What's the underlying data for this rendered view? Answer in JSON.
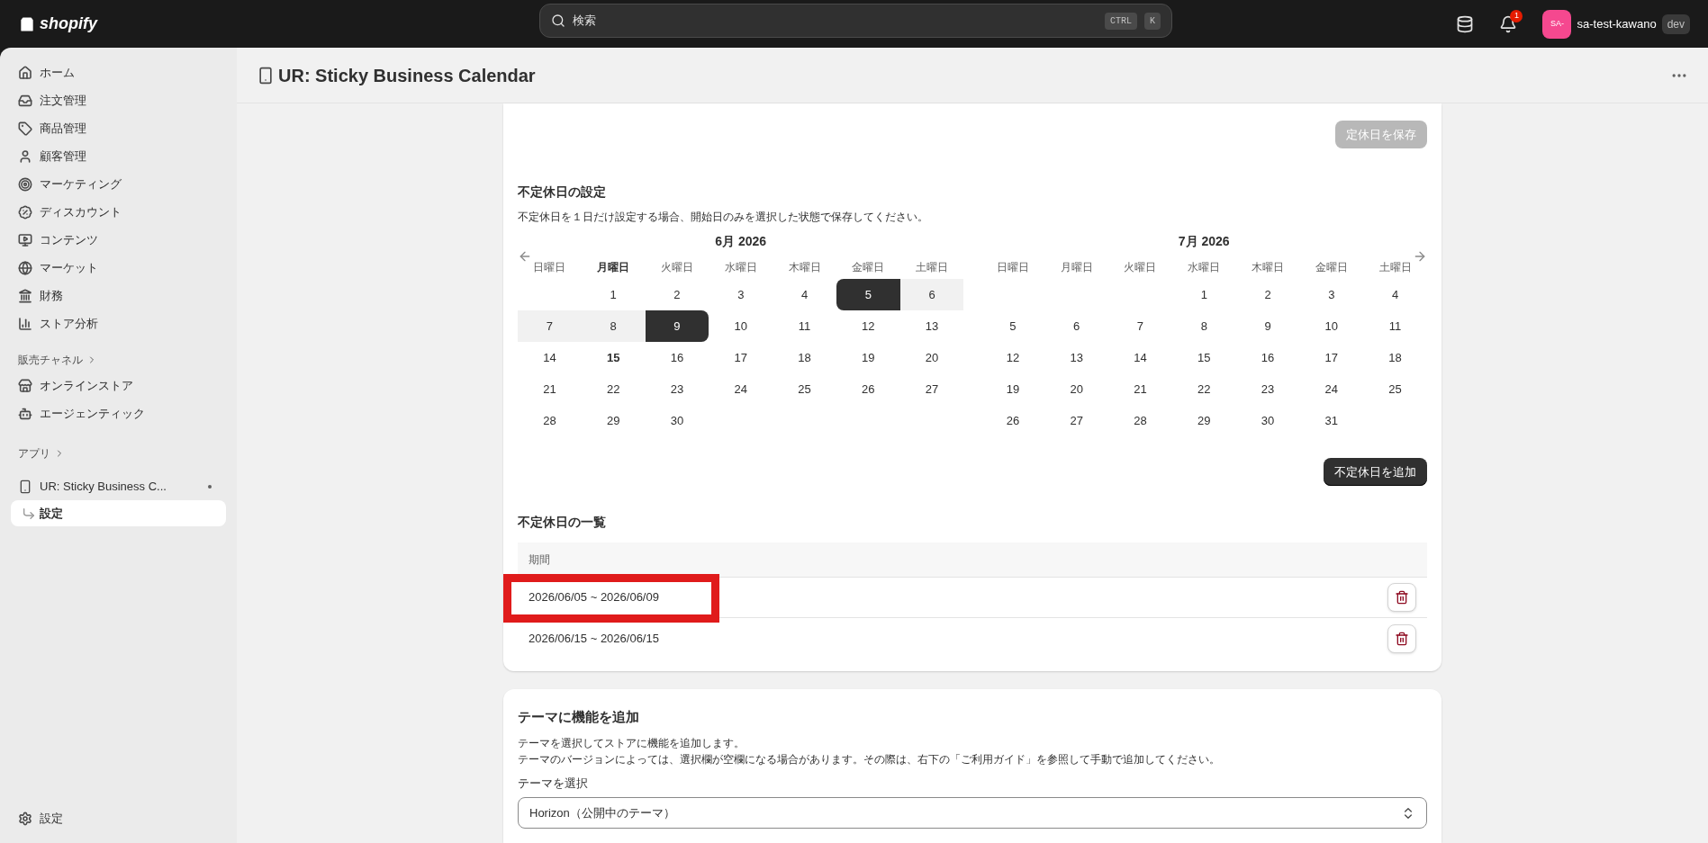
{
  "top_bar": {
    "logo": "shopify",
    "search": {
      "placeholder": "検索"
    },
    "shortcut_keys": [
      "CTRL",
      "K"
    ],
    "notification_count": "1",
    "avatar": "SA-",
    "store_name": "sa-test-kawano",
    "store_badge": "dev"
  },
  "sidebar": {
    "items": [
      {
        "label": "ホーム",
        "selected": false
      },
      {
        "label": "注文管理",
        "selected": false
      },
      {
        "label": "商品管理",
        "selected": false
      },
      {
        "label": "顧客管理",
        "selected": false
      },
      {
        "label": "マーケティング",
        "selected": false
      },
      {
        "label": "ディスカウント",
        "selected": false
      },
      {
        "label": "コンテンツ",
        "selected": false
      },
      {
        "label": "マーケット",
        "selected": false
      },
      {
        "label": "財務",
        "selected": false
      },
      {
        "label": "ストア分析",
        "selected": false
      }
    ],
    "sales_channels": {
      "title": "販売チャネル",
      "items": [
        {
          "label": "オンラインストア",
          "selected": false
        },
        {
          "label": "エージェンティック",
          "selected": false
        }
      ]
    },
    "apps": {
      "title": "アプリ",
      "items": [
        {
          "label": "UR: Sticky Business C...",
          "selected": false,
          "children": [
            {
              "label": "設定",
              "selected": true
            }
          ]
        }
      ]
    },
    "footer_item": {
      "label": "設定",
      "selected": false
    }
  },
  "page_header": {
    "title": "UR: Sticky Business Calendar"
  },
  "holiday_card": {
    "save_button": {
      "label": "定休日を保存",
      "disabled": true
    },
    "title": "不定休日の設定",
    "description": "不定休日を１日だけ設定する場合、開始日のみを選択した状態で保存してください。",
    "calendars": [
      {
        "title": "6月 2026",
        "weekdays": [
          {
            "label": "日曜日",
            "today": false
          },
          {
            "label": "月曜日",
            "today": true
          },
          {
            "label": "火曜日",
            "today": false
          },
          {
            "label": "水曜日",
            "today": false
          },
          {
            "label": "木曜日",
            "today": false
          },
          {
            "label": "金曜日",
            "today": false
          },
          {
            "label": "土曜日",
            "today": false
          }
        ],
        "cells": [
          {
            "kind": "blank"
          },
          {
            "kind": "day",
            "day": "1",
            "range_start": false,
            "range_end": false,
            "in_range": false,
            "today": false
          },
          {
            "kind": "day",
            "day": "2",
            "range_start": false,
            "range_end": false,
            "in_range": false,
            "today": false
          },
          {
            "kind": "day",
            "day": "3",
            "range_start": false,
            "range_end": false,
            "in_range": false,
            "today": false
          },
          {
            "kind": "day",
            "day": "4",
            "range_start": false,
            "range_end": false,
            "in_range": false,
            "today": false
          },
          {
            "kind": "day",
            "day": "5",
            "range_start": true,
            "range_end": false,
            "in_range": true,
            "today": false
          },
          {
            "kind": "day",
            "day": "6",
            "range_start": false,
            "range_end": false,
            "in_range": true,
            "today": false
          },
          {
            "kind": "day",
            "day": "7",
            "range_start": false,
            "range_end": false,
            "in_range": true,
            "today": false
          },
          {
            "kind": "day",
            "day": "8",
            "range_start": false,
            "range_end": false,
            "in_range": true,
            "today": false
          },
          {
            "kind": "day",
            "day": "9",
            "range_start": false,
            "range_end": true,
            "in_range": true,
            "today": false
          },
          {
            "kind": "day",
            "day": "10",
            "range_start": false,
            "range_end": false,
            "in_range": false,
            "today": false
          },
          {
            "kind": "day",
            "day": "11",
            "range_start": false,
            "range_end": false,
            "in_range": false,
            "today": false
          },
          {
            "kind": "day",
            "day": "12",
            "range_start": false,
            "range_end": false,
            "in_range": false,
            "today": false
          },
          {
            "kind": "day",
            "day": "13",
            "range_start": false,
            "range_end": false,
            "in_range": false,
            "today": false
          },
          {
            "kind": "day",
            "day": "14",
            "range_start": false,
            "range_end": false,
            "in_range": false,
            "today": false
          },
          {
            "kind": "day",
            "day": "15",
            "range_start": false,
            "range_end": false,
            "in_range": false,
            "today": true
          },
          {
            "kind": "day",
            "day": "16",
            "range_start": false,
            "range_end": false,
            "in_range": false,
            "today": false
          },
          {
            "kind": "day",
            "day": "17",
            "range_start": false,
            "range_end": false,
            "in_range": false,
            "today": false
          },
          {
            "kind": "day",
            "day": "18",
            "range_start": false,
            "range_end": false,
            "in_range": false,
            "today": false
          },
          {
            "kind": "day",
            "day": "19",
            "range_start": false,
            "range_end": false,
            "in_range": false,
            "today": false
          },
          {
            "kind": "day",
            "day": "20",
            "range_start": false,
            "range_end": false,
            "in_range": false,
            "today": false
          },
          {
            "kind": "day",
            "day": "21",
            "range_start": false,
            "range_end": false,
            "in_range": false,
            "today": false
          },
          {
            "kind": "day",
            "day": "22",
            "range_start": false,
            "range_end": false,
            "in_range": false,
            "today": false
          },
          {
            "kind": "day",
            "day": "23",
            "range_start": false,
            "range_end": false,
            "in_range": false,
            "today": false
          },
          {
            "kind": "day",
            "day": "24",
            "range_start": false,
            "range_end": false,
            "in_range": false,
            "today": false
          },
          {
            "kind": "day",
            "day": "25",
            "range_start": false,
            "range_end": false,
            "in_range": false,
            "today": false
          },
          {
            "kind": "day",
            "day": "26",
            "range_start": false,
            "range_end": false,
            "in_range": false,
            "today": false
          },
          {
            "kind": "day",
            "day": "27",
            "range_start": false,
            "range_end": false,
            "in_range": false,
            "today": false
          },
          {
            "kind": "day",
            "day": "28",
            "range_start": false,
            "range_end": false,
            "in_range": false,
            "today": false
          },
          {
            "kind": "day",
            "day": "29",
            "range_start": false,
            "range_end": false,
            "in_range": false,
            "today": false
          },
          {
            "kind": "day",
            "day": "30",
            "range_start": false,
            "range_end": false,
            "in_range": false,
            "today": false
          }
        ]
      },
      {
        "title": "7月 2026",
        "weekdays": [
          {
            "label": "日曜日",
            "today": false
          },
          {
            "label": "月曜日",
            "today": false
          },
          {
            "label": "火曜日",
            "today": false
          },
          {
            "label": "水曜日",
            "today": false
          },
          {
            "label": "木曜日",
            "today": false
          },
          {
            "label": "金曜日",
            "today": false
          },
          {
            "label": "土曜日",
            "today": false
          }
        ],
        "cells": [
          {
            "kind": "blank"
          },
          {
            "kind": "blank"
          },
          {
            "kind": "blank"
          },
          {
            "kind": "day",
            "day": "1",
            "range_start": false,
            "range_end": false,
            "in_range": false,
            "today": false
          },
          {
            "kind": "day",
            "day": "2",
            "range_start": false,
            "range_end": false,
            "in_range": false,
            "today": false
          },
          {
            "kind": "day",
            "day": "3",
            "range_start": false,
            "range_end": false,
            "in_range": false,
            "today": false
          },
          {
            "kind": "day",
            "day": "4",
            "range_start": false,
            "range_end": false,
            "in_range": false,
            "today": false
          },
          {
            "kind": "day",
            "day": "5",
            "range_start": false,
            "range_end": false,
            "in_range": false,
            "today": false
          },
          {
            "kind": "day",
            "day": "6",
            "range_start": false,
            "range_end": false,
            "in_range": false,
            "today": false
          },
          {
            "kind": "day",
            "day": "7",
            "range_start": false,
            "range_end": false,
            "in_range": false,
            "today": false
          },
          {
            "kind": "day",
            "day": "8",
            "range_start": false,
            "range_end": false,
            "in_range": false,
            "today": false
          },
          {
            "kind": "day",
            "day": "9",
            "range_start": false,
            "range_end": false,
            "in_range": false,
            "today": false
          },
          {
            "kind": "day",
            "day": "10",
            "range_start": false,
            "range_end": false,
            "in_range": false,
            "today": false
          },
          {
            "kind": "day",
            "day": "11",
            "range_start": false,
            "range_end": false,
            "in_range": false,
            "today": false
          },
          {
            "kind": "day",
            "day": "12",
            "range_start": false,
            "range_end": false,
            "in_range": false,
            "today": false
          },
          {
            "kind": "day",
            "day": "13",
            "range_start": false,
            "range_end": false,
            "in_range": false,
            "today": false
          },
          {
            "kind": "day",
            "day": "14",
            "range_start": false,
            "range_end": false,
            "in_range": false,
            "today": false
          },
          {
            "kind": "day",
            "day": "15",
            "range_start": false,
            "range_end": false,
            "in_range": false,
            "today": false
          },
          {
            "kind": "day",
            "day": "16",
            "range_start": false,
            "range_end": false,
            "in_range": false,
            "today": false
          },
          {
            "kind": "day",
            "day": "17",
            "range_start": false,
            "range_end": false,
            "in_range": false,
            "today": false
          },
          {
            "kind": "day",
            "day": "18",
            "range_start": false,
            "range_end": false,
            "in_range": false,
            "today": false
          },
          {
            "kind": "day",
            "day": "19",
            "range_start": false,
            "range_end": false,
            "in_range": false,
            "today": false
          },
          {
            "kind": "day",
            "day": "20",
            "range_start": false,
            "range_end": false,
            "in_range": false,
            "today": false
          },
          {
            "kind": "day",
            "day": "21",
            "range_start": false,
            "range_end": false,
            "in_range": false,
            "today": false
          },
          {
            "kind": "day",
            "day": "22",
            "range_start": false,
            "range_end": false,
            "in_range": false,
            "today": false
          },
          {
            "kind": "day",
            "day": "23",
            "range_start": false,
            "range_end": false,
            "in_range": false,
            "today": false
          },
          {
            "kind": "day",
            "day": "24",
            "range_start": false,
            "range_end": false,
            "in_range": false,
            "today": false
          },
          {
            "kind": "day",
            "day": "25",
            "range_start": false,
            "range_end": false,
            "in_range": false,
            "today": false
          },
          {
            "kind": "day",
            "day": "26",
            "range_start": false,
            "range_end": false,
            "in_range": false,
            "today": false
          },
          {
            "kind": "day",
            "day": "27",
            "range_start": false,
            "range_end": false,
            "in_range": false,
            "today": false
          },
          {
            "kind": "day",
            "day": "28",
            "range_start": false,
            "range_end": false,
            "in_range": false,
            "today": false
          },
          {
            "kind": "day",
            "day": "29",
            "range_start": false,
            "range_end": false,
            "in_range": false,
            "today": false
          },
          {
            "kind": "day",
            "day": "30",
            "range_start": false,
            "range_end": false,
            "in_range": false,
            "today": false
          },
          {
            "kind": "day",
            "day": "31",
            "range_start": false,
            "range_end": false,
            "in_range": false,
            "today": false
          }
        ]
      }
    ],
    "add_button": "不定休日を追加",
    "list_title": "不定休日の一覧",
    "table": {
      "columns": [
        "期間"
      ],
      "rows": [
        {
          "period": "2026/06/05 ~ 2026/06/09",
          "highlighted": true
        },
        {
          "period": "2026/06/15 ~ 2026/06/15",
          "highlighted": false
        }
      ]
    }
  },
  "theme_card": {
    "title": "テーマに機能を追加",
    "description_lines": [
      "テーマを選択してストアに機能を追加します。",
      "テーマのバージョンによっては、選択欄が空欄になる場合があります。その際は、右下の「ご利用ガイド」を参照して手動で追加してください。"
    ],
    "select_label": "テーマを選択",
    "select_value": "Horizon（公開中のテーマ）"
  }
}
